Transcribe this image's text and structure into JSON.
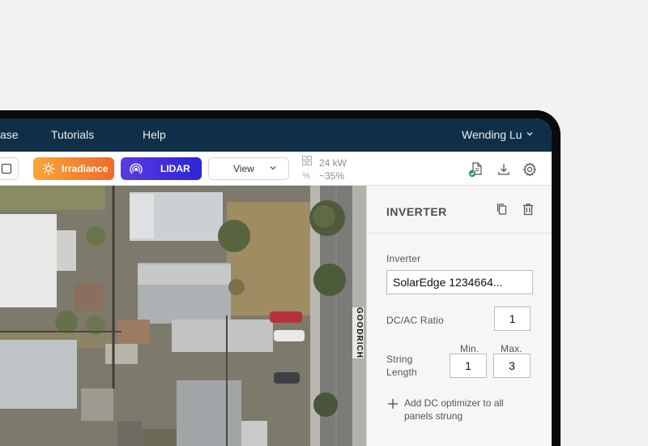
{
  "nav": {
    "left_item": "ase",
    "tutorials": "Tutorials",
    "help": "Help",
    "user": "Wending Lu"
  },
  "toolbar": {
    "irradiance_label": "Irradiance",
    "lidar_label": "LIDAR",
    "view_label": "View",
    "power": "24 kW",
    "percent_symbol": "%",
    "percent_value": "~35%"
  },
  "panel": {
    "title": "INVERTER",
    "inverter_label": "Inverter",
    "inverter_value": "SolarEdge 1234664...",
    "dcac_label": "DC/AC Ratio",
    "dcac_value": "1",
    "string_label_1": "String",
    "string_label_2": "Length",
    "min_label": "Min.",
    "max_label": "Max.",
    "min_value": "1",
    "max_value": "3",
    "add_optimizer": "Add DC optimizer to all panels strung"
  },
  "map": {
    "street_label": "GOODRICH"
  },
  "colors": {
    "nav_bg": "#0e2f47",
    "irradiance_start": "#f7a637",
    "irradiance_end": "#f06a2c",
    "lidar_start": "#5a3be0",
    "lidar_end": "#2b24d6",
    "check_green": "#1f9a5a"
  }
}
